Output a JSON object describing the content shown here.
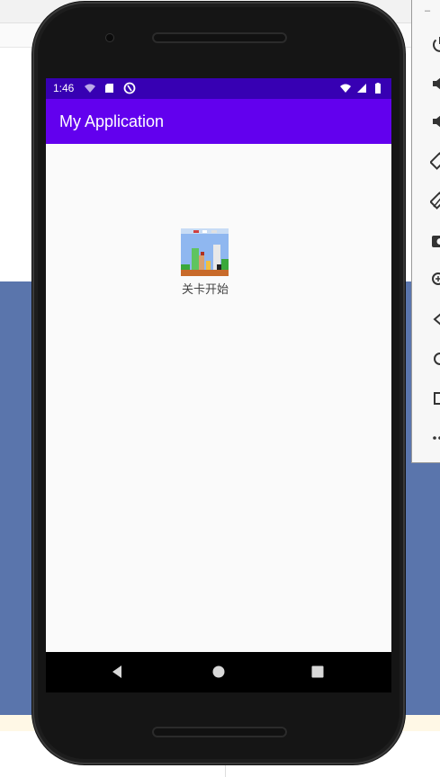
{
  "app": {
    "status_time": "1:46",
    "title": "My Application"
  },
  "level": {
    "label": "关卡开始",
    "thumbnail_icon": "game-level-icon"
  },
  "colors": {
    "status_bar": "#3700b3",
    "app_bar": "#6200ee",
    "screen_bg": "#fafafa",
    "host_blue": "#5a75ac"
  },
  "side_toolbar": {
    "items": [
      "power-icon",
      "volume-up-icon",
      "volume-down-icon",
      "rotate-left-icon",
      "rotate-right-icon",
      "camera-icon",
      "zoom-icon",
      "back-icon",
      "home-icon",
      "overview-icon",
      "more-icon"
    ]
  },
  "nav": {
    "items": [
      "back-icon",
      "home-icon",
      "recents-icon"
    ]
  }
}
